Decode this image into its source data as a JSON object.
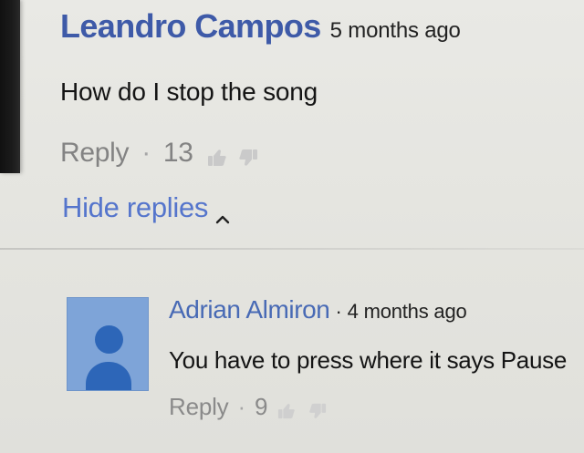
{
  "comment": {
    "author": "Leandro Campos",
    "time": "5 months ago",
    "text": "How do I stop  the song",
    "reply_label": "Reply",
    "separator": "·",
    "likes": "13",
    "hide_replies_label": "Hide replies"
  },
  "reply": {
    "author": "Adrian Almiron",
    "separator": "·",
    "time": "4 months ago",
    "text": "You have to press where it says Pause",
    "reply_label": "Reply",
    "likes": "9"
  },
  "icons": {
    "like": "thumbs-up-icon",
    "dislike": "thumbs-down-icon",
    "collapse": "chevron-up-icon",
    "avatar": "default-user-avatar-icon"
  },
  "colors": {
    "author_blue": "#3e5aa8",
    "link_blue": "#5575cc",
    "avatar_bg": "#7ea4d8",
    "avatar_fg": "#2d66b8",
    "text_dark": "#141414",
    "muted_gray": "#838383"
  }
}
